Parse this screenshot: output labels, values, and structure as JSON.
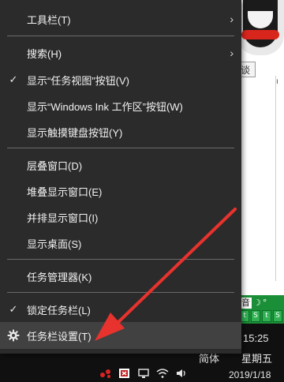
{
  "background": {
    "chat_button_label": "谈",
    "side_glyph": "ı",
    "ime_bar": {
      "top_cells": [
        "音",
        "☽",
        "°"
      ],
      "icons": [
        "t",
        "S",
        "t",
        "S"
      ]
    }
  },
  "menu": {
    "items": [
      {
        "label": "工具栏(T)",
        "has_submenu": true,
        "checked": false
      },
      {
        "label": "搜索(H)",
        "has_submenu": true,
        "checked": false
      },
      {
        "label": "显示“任务视图”按钮(V)",
        "has_submenu": false,
        "checked": true
      },
      {
        "label": "显示“Windows Ink 工作区”按钮(W)",
        "has_submenu": false,
        "checked": false
      },
      {
        "label": "显示触摸键盘按钮(Y)",
        "has_submenu": false,
        "checked": false
      },
      {
        "label": "层叠窗口(D)",
        "has_submenu": false,
        "checked": false
      },
      {
        "label": "堆叠显示窗口(E)",
        "has_submenu": false,
        "checked": false
      },
      {
        "label": "并排显示窗口(I)",
        "has_submenu": false,
        "checked": false
      },
      {
        "label": "显示桌面(S)",
        "has_submenu": false,
        "checked": false
      },
      {
        "label": "任务管理器(K)",
        "has_submenu": false,
        "checked": false
      },
      {
        "label": "锁定任务栏(L)",
        "has_submenu": false,
        "checked": true
      },
      {
        "label": "任务栏设置(T)",
        "has_submenu": false,
        "checked": false,
        "icon": "gear-icon",
        "highlighted": true
      }
    ],
    "check_glyph": "✓",
    "submenu_glyph": "›"
  },
  "taskbar": {
    "time": "15:25",
    "ime_mode": "简体",
    "weekday": "星期五",
    "date": "2019/1/18",
    "tray_icons": [
      "network-cluster-icon",
      "antivirus-icon",
      "display-icon",
      "wifi-icon",
      "volume-icon"
    ]
  },
  "colors": {
    "menu_bg": "#2b2b2b",
    "menu_highlight": "#414141",
    "separator": "#6a6a6a",
    "taskbar_bg": "#101010",
    "annotation_red": "#e8322d",
    "ime_green": "#1b8f37"
  }
}
